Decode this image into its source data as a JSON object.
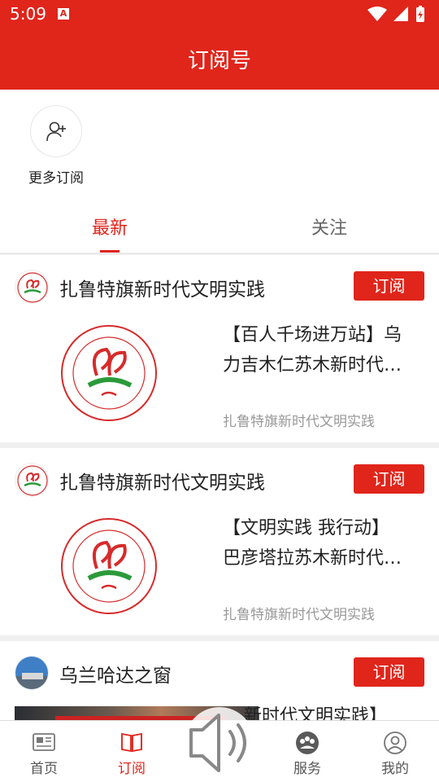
{
  "status_bar": {
    "time": "5:09",
    "a_icon": "A"
  },
  "header": {
    "title": "订阅号"
  },
  "more": {
    "label": "更多订阅"
  },
  "tabs": [
    {
      "label": "最新",
      "active": true
    },
    {
      "label": "关注",
      "active": false
    }
  ],
  "feed": [
    {
      "name": "扎鲁特旗新时代文明实践",
      "subscribe_label": "订阅",
      "headline_line1": "【百人千场进万站】乌",
      "headline_line2": "力吉木仁苏木新时代…",
      "source": "扎鲁特旗新时代文明实践"
    },
    {
      "name": "扎鲁特旗新时代文明实践",
      "subscribe_label": "订阅",
      "headline_line1": "【文明实践  我行动】",
      "headline_line2": "巴彦塔拉苏木新时代…",
      "source": "扎鲁特旗新时代文明实践"
    },
    {
      "name": "乌兰哈达之窗",
      "subscribe_label": "订阅",
      "headline_partial": "新时代文明实践】"
    }
  ],
  "bottom_nav": [
    {
      "label": "首页",
      "icon": "news-icon"
    },
    {
      "label": "订阅",
      "icon": "book-icon",
      "active": true
    },
    {
      "label": "",
      "icon": "speaker-icon"
    },
    {
      "label": "服务",
      "icon": "services-icon"
    },
    {
      "label": "我的",
      "icon": "profile-icon"
    }
  ],
  "colors": {
    "accent": "#e0251b",
    "text": "#222222",
    "muted": "#999999"
  }
}
